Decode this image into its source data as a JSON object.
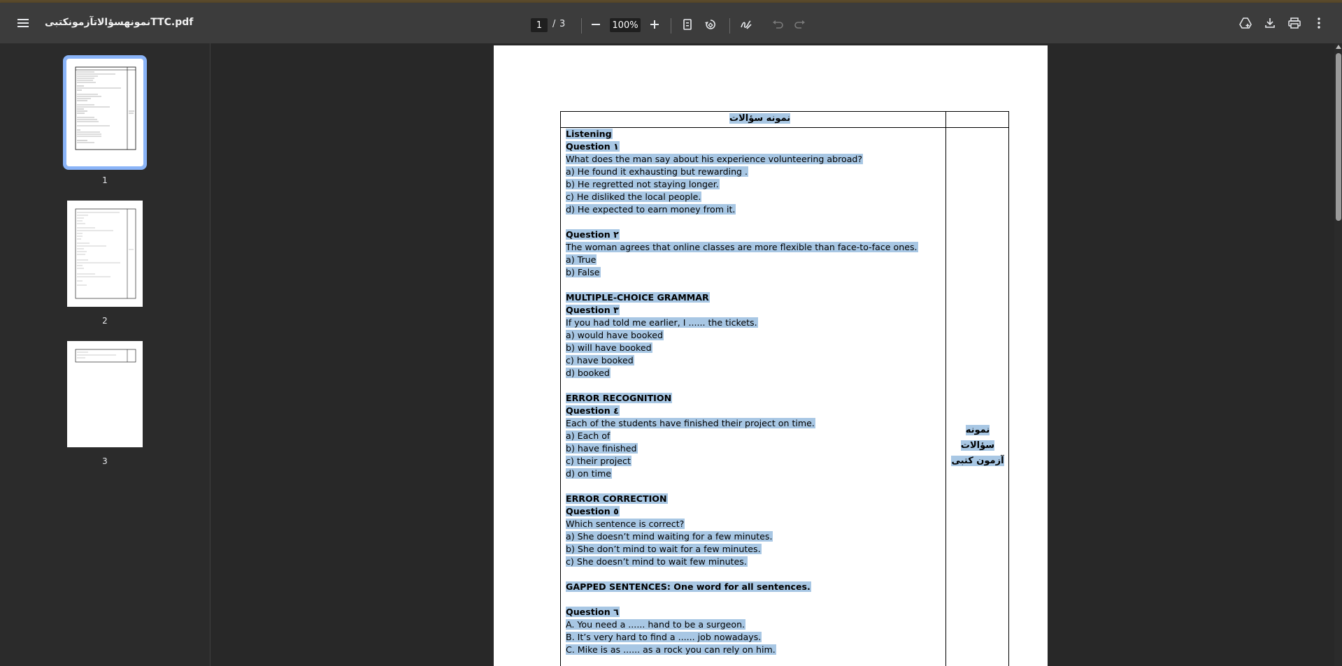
{
  "app": {
    "title": "نمونهسؤالاتآزمونکتبیTTC.pdf"
  },
  "toolbar": {
    "page_current": "1",
    "page_separator": "/",
    "page_total": "3",
    "zoom": "100%"
  },
  "thumbnails": [
    {
      "label": "1",
      "selected": true
    },
    {
      "label": "2",
      "selected": false
    },
    {
      "label": "3",
      "selected": false
    }
  ],
  "document": {
    "header_title": "نمونه سؤالات",
    "side_label_line1": "نمونه سؤالات",
    "side_label_line2": "آزمون کتبی",
    "lines": [
      {
        "text": "Listening",
        "bold": true
      },
      {
        "text": "Question ١",
        "bold": true
      },
      {
        "text": "What does the man say about his experience volunteering abroad?",
        "bold": false
      },
      {
        "text": "a) He found it exhausting but rewarding .",
        "bold": false
      },
      {
        "text": "b) He regretted not staying longer.",
        "bold": false
      },
      {
        "text": "c) He disliked the local people.",
        "bold": false
      },
      {
        "text": "d) He expected to earn money from it.",
        "bold": false
      },
      {
        "text": "",
        "bold": false
      },
      {
        "text": "Question ٢",
        "bold": true
      },
      {
        "text": "The woman agrees that online classes are more flexible than face-to-face ones.",
        "bold": false
      },
      {
        "text": "a) True",
        "bold": false
      },
      {
        "text": "b) False",
        "bold": false
      },
      {
        "text": "",
        "bold": false
      },
      {
        "text": "MULTIPLE-CHOICE GRAMMAR",
        "bold": true
      },
      {
        "text": "Question ٣",
        "bold": true
      },
      {
        "text": "If you had told me earlier, I ...... the tickets.",
        "bold": false
      },
      {
        "text": "a) would have booked",
        "bold": false
      },
      {
        "text": "b) will have booked",
        "bold": false
      },
      {
        "text": "c) have booked",
        "bold": false
      },
      {
        "text": "d) booked",
        "bold": false
      },
      {
        "text": "",
        "bold": false
      },
      {
        "text": "ERROR RECOGNITION",
        "bold": true
      },
      {
        "text": "Question ٤",
        "bold": true
      },
      {
        "text": "Each of the students have finished their project on time.",
        "bold": false
      },
      {
        "text": "a) Each of",
        "bold": false
      },
      {
        "text": "b) have finished",
        "bold": false
      },
      {
        "text": "c) their project",
        "bold": false
      },
      {
        "text": "d) on time",
        "bold": false
      },
      {
        "text": "",
        "bold": false
      },
      {
        "text": "ERROR CORRECTION",
        "bold": true
      },
      {
        "text": "Question ٥",
        "bold": true
      },
      {
        "text": "Which sentence is correct?",
        "bold": false
      },
      {
        "text": "a) She doesn’t mind waiting for a few minutes.",
        "bold": false
      },
      {
        "text": "b) She don’t mind to wait for a few minutes.",
        "bold": false
      },
      {
        "text": "c) She doesn’t mind to wait few minutes.",
        "bold": false
      },
      {
        "text": "",
        "bold": false
      },
      {
        "text": "GAPPED SENTENCES: One word for all sentences.",
        "bold": true
      },
      {
        "text": "",
        "bold": false
      },
      {
        "text": "Question ٦",
        "bold": true
      },
      {
        "text": "A. You need a ...... hand to be a surgeon.",
        "bold": false
      },
      {
        "text": "B. It’s very hard to find a ...... job nowadays.",
        "bold": false
      },
      {
        "text": "C. Mike is as ...... as a rock you can rely on him.",
        "bold": false
      }
    ]
  },
  "icons": {
    "menu": "hamburger-menu-icon",
    "zoom_out": "minus-icon",
    "zoom_in": "plus-icon",
    "fit": "fit-page-icon",
    "rotate": "rotate-icon",
    "annotate": "draw-icon",
    "undo": "undo-icon",
    "redo": "redo-icon",
    "drive": "save-to-drive-icon",
    "download": "download-icon",
    "print": "print-icon",
    "more": "more-vert-icon"
  },
  "colors": {
    "toolbar_bg": "#3c3c3c",
    "viewer_bg": "#282828",
    "selection_highlight": "#a8c7e4",
    "thumb_selected_border": "#8ab4f8"
  }
}
